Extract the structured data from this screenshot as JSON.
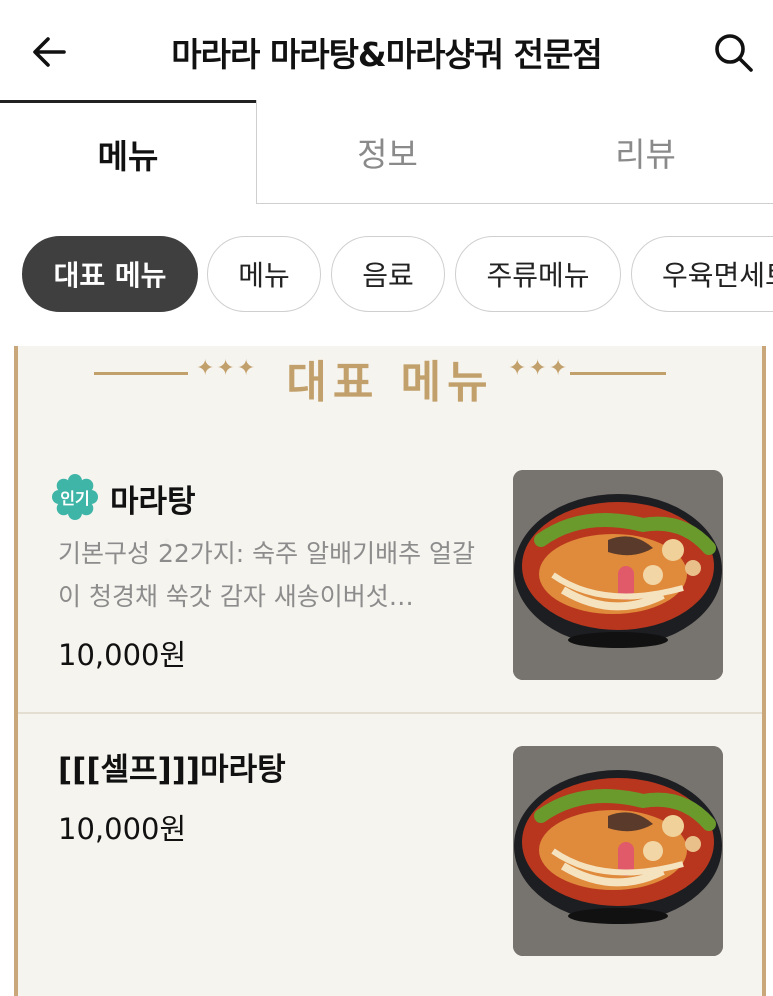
{
  "header": {
    "title": "마라라 마라탕&마라샹궈 전문점",
    "back_icon": "arrow-left-icon",
    "search_icon": "search-icon"
  },
  "tabs": [
    {
      "label": "메뉴",
      "active": true
    },
    {
      "label": "정보",
      "active": false
    },
    {
      "label": "리뷰",
      "active": false
    }
  ],
  "chips": [
    {
      "label": "대표 메뉴",
      "active": true
    },
    {
      "label": "메뉴",
      "active": false
    },
    {
      "label": "음료",
      "active": false
    },
    {
      "label": "주류메뉴",
      "active": false
    },
    {
      "label": "우육면세트",
      "active": false
    }
  ],
  "section": {
    "title": "대표 메뉴"
  },
  "items": [
    {
      "badge": "인기",
      "name": "마라탕",
      "description": "기본구성 22가지: 숙주 알배기배추 얼갈이 청경채 쑥갓 감자 새송이버섯…",
      "price": "10,000원",
      "image_icon": "malatang-bowl-photo"
    },
    {
      "name": "[[[셀프]]]마라탕",
      "price": "10,000원",
      "image_icon": "malatang-bowl-photo"
    }
  ],
  "colors": {
    "accent_gold": "#c2a06b",
    "chip_active": "#3f3f3f",
    "badge_teal": "#3fb5a8"
  }
}
